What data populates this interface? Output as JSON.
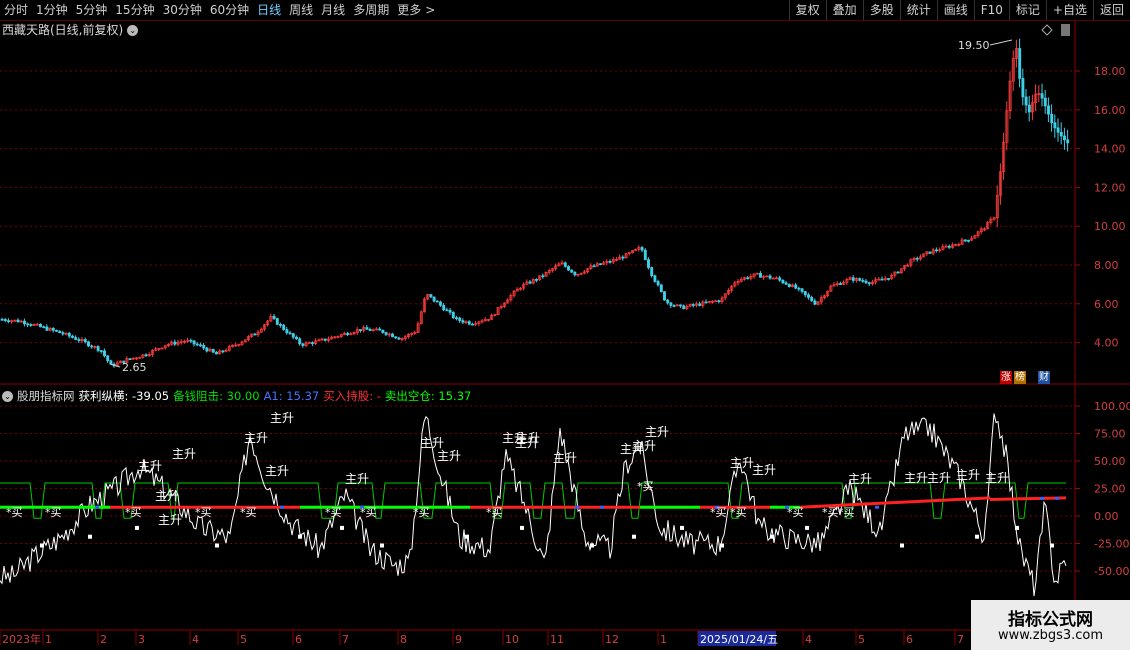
{
  "toolbar": {
    "periods": [
      "分时",
      "1分钟",
      "5分钟",
      "15分钟",
      "30分钟",
      "60分钟",
      "日线",
      "周线",
      "月线",
      "多周期",
      "更多"
    ],
    "active_period": "日线",
    "more_arrow": ">",
    "actions": [
      "复权",
      "叠加",
      "多股",
      "统计",
      "画线",
      "F10",
      "标记",
      "+自选",
      "返回"
    ]
  },
  "price_chart": {
    "title": "西藏天路(日线,前复权)",
    "high_label": "19.50",
    "low_label": "2.65",
    "y_ticks": [
      "18.00",
      "16.00",
      "14.00",
      "12.00",
      "10.00",
      "8.00",
      "6.00",
      "4.00"
    ],
    "badges": [
      "涨",
      "榜",
      "财"
    ],
    "diamond_icon": "diamond-icon"
  },
  "indicator": {
    "name": "股朋指标网",
    "line1_label": "获利纵横: -39.05",
    "line2_label": "备钱阻击: 30.00",
    "line3_label": "A1: 15.37",
    "line4_label": "买入持股: -",
    "line5_label": "卖出空仓: 15.37",
    "y_ticks": [
      "100.00",
      "75.00",
      "50.00",
      "25.00",
      "0.00",
      "-25.00",
      "-50.00"
    ],
    "rise_label": "主升",
    "buy_label": "*买",
    "colors": {
      "profit_line": "#ffffff",
      "resist_line": "#00dd00",
      "hold": "#ff2020",
      "sell": "#00ff00",
      "a1": "#3060ff"
    }
  },
  "date_axis": {
    "labels": [
      "2023年",
      "1",
      "2",
      "3",
      "4",
      "5",
      "6",
      "7",
      "8",
      "9",
      "10",
      "11",
      "12",
      "1",
      "2025/01/24/五",
      "4",
      "5",
      "6",
      "7"
    ]
  },
  "watermark": {
    "title": "指标公式网",
    "url": "www.zbgs3.com"
  },
  "chart_data": {
    "type": "line",
    "title": "西藏天路(日线,前复权)",
    "price_ylim": [
      3.0,
      19.6
    ],
    "price_series": [
      [
        0,
        5.2
      ],
      [
        20,
        5.1
      ],
      [
        40,
        4.8
      ],
      [
        60,
        4.5
      ],
      [
        80,
        4.1
      ],
      [
        100,
        3.6
      ],
      [
        110,
        2.8
      ],
      [
        125,
        3.1
      ],
      [
        145,
        3.4
      ],
      [
        165,
        3.9
      ],
      [
        185,
        4.1
      ],
      [
        200,
        3.8
      ],
      [
        215,
        3.4
      ],
      [
        235,
        3.9
      ],
      [
        255,
        4.5
      ],
      [
        270,
        5.3
      ],
      [
        285,
        4.6
      ],
      [
        300,
        3.9
      ],
      [
        320,
        4.1
      ],
      [
        340,
        4.4
      ],
      [
        360,
        4.7
      ],
      [
        380,
        4.6
      ],
      [
        400,
        4.2
      ],
      [
        415,
        4.6
      ],
      [
        425,
        6.5
      ],
      [
        440,
        5.9
      ],
      [
        455,
        5.2
      ],
      [
        470,
        5.0
      ],
      [
        490,
        5.3
      ],
      [
        505,
        6.2
      ],
      [
        520,
        6.9
      ],
      [
        540,
        7.4
      ],
      [
        560,
        8.1
      ],
      [
        575,
        7.5
      ],
      [
        590,
        7.9
      ],
      [
        610,
        8.2
      ],
      [
        625,
        8.5
      ],
      [
        640,
        8.9
      ],
      [
        650,
        7.6
      ],
      [
        665,
        6.1
      ],
      [
        680,
        5.8
      ],
      [
        700,
        6.0
      ],
      [
        720,
        6.2
      ],
      [
        735,
        7.2
      ],
      [
        755,
        7.5
      ],
      [
        775,
        7.3
      ],
      [
        795,
        6.8
      ],
      [
        815,
        6.0
      ],
      [
        830,
        6.9
      ],
      [
        850,
        7.3
      ],
      [
        870,
        7.1
      ],
      [
        890,
        7.4
      ],
      [
        910,
        8.2
      ],
      [
        930,
        8.7
      ],
      [
        950,
        9.0
      ],
      [
        970,
        9.4
      ],
      [
        985,
        10.0
      ],
      [
        993,
        10.5
      ],
      [
        1000,
        13.0
      ],
      [
        1005,
        15.5
      ],
      [
        1010,
        18.0
      ],
      [
        1015,
        19.3
      ],
      [
        1020,
        17.0
      ],
      [
        1028,
        15.8
      ],
      [
        1036,
        17.1
      ],
      [
        1044,
        16.3
      ],
      [
        1052,
        15.2
      ],
      [
        1060,
        14.6
      ],
      [
        1066,
        14.3
      ]
    ],
    "indicator_ylim": [
      -52,
      100
    ],
    "resistance_level": 30.0,
    "a1_level": 15.37
  }
}
